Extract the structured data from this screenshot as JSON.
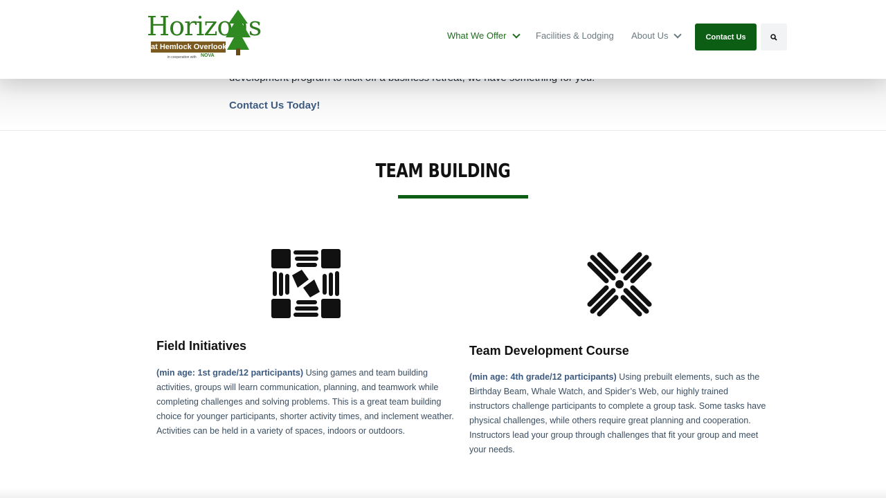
{
  "header": {
    "logo": {
      "word": "Horizons",
      "banner": "at Hemlock Overlook",
      "sub": "in cooperation with",
      "nova": "NOVA"
    },
    "nav": [
      {
        "label": "What We Offer",
        "active": true,
        "has_dropdown": true
      },
      {
        "label": "Facilities & Lodging",
        "active": false,
        "has_dropdown": false
      },
      {
        "label": "About Us",
        "active": false,
        "has_dropdown": true
      }
    ],
    "contact_label": "Contact Us",
    "search_icon": "search-icon"
  },
  "intro": {
    "text": "development program to kick off a business retreat, we have something for you.",
    "link": "Contact Us Today!"
  },
  "section": {
    "title": "TEAM BUILDING",
    "accent": "#0b5e14"
  },
  "cards": [
    {
      "icon": "stacked-hands-icon",
      "title": "Field Initiatives",
      "bold": "(min age: 1st grade/12 participants)",
      "text": "Using games and team building activities, groups will learn communication, planning, and teamwork while completing challenges and solving problems. This is a great team building choice for younger participants, shorter activity times, and inclement weather. Activities can be held in a variety of spaces, indoors or outdoors."
    },
    {
      "icon": "team-circle-icon",
      "title": "Team Development Course",
      "bold": "(min age: 4th grade/12 participants)",
      "text": "Using prebuilt elements, such as the Birthday Beam, Whale Watch, and Spider’s Web, our highly trained instructors challenge participants to complete a group task. Some tasks have physical challenges, while others require great planning and cooperation. Instructors lead your group through challenges that fit your group and meet your needs."
    }
  ]
}
